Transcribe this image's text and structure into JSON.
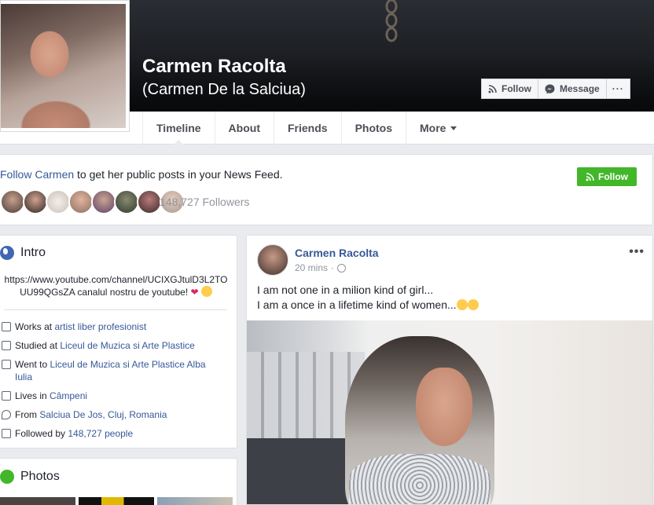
{
  "profile": {
    "name": "Carmen Racolta",
    "alternate_name": "(Carmen De la Salciua)"
  },
  "cover_actions": {
    "follow": "Follow",
    "message": "Message",
    "more": "···"
  },
  "tabs": [
    {
      "label": "Timeline"
    },
    {
      "label": "About"
    },
    {
      "label": "Friends"
    },
    {
      "label": "Photos"
    },
    {
      "label": "More"
    }
  ],
  "follow_card": {
    "link": "Follow Carmen",
    "text": " to get her public posts in your News Feed.",
    "followers": "148,727 Followers",
    "button": "Follow"
  },
  "intro": {
    "title": "Intro",
    "bio": "https://www.youtube.com/channel/UCIXGJtulD3L2TOUU99QGsZA canalul nostru de youtube!",
    "items": [
      {
        "prefix": "Works at ",
        "link": "artist liber profesionist",
        "suffix": ""
      },
      {
        "prefix": "Studied at ",
        "link": "Liceul de Muzica si Arte Plastice",
        "suffix": ""
      },
      {
        "prefix": "Went to ",
        "link": "Liceul de Muzica si Arte Plastice Alba Iulia",
        "suffix": ""
      },
      {
        "prefix": "Lives in ",
        "link": "Câmpeni",
        "suffix": ""
      },
      {
        "prefix": "From ",
        "link": "Salciua De Jos, Cluj, Romania",
        "suffix": ""
      },
      {
        "prefix": "Followed by ",
        "link": "148,727 people",
        "suffix": ""
      }
    ]
  },
  "photos_card": {
    "title": "Photos"
  },
  "post": {
    "author": "Carmen Racolta",
    "time": "20 mins",
    "separator": "·",
    "more": "•••",
    "line1": "I am not one in a milion kind of girl...",
    "line2": "I am a once in a lifetime kind of women..."
  },
  "colors": {
    "link": "#365899",
    "follow_green": "#42b72a",
    "page_bg": "#e9ebee"
  }
}
